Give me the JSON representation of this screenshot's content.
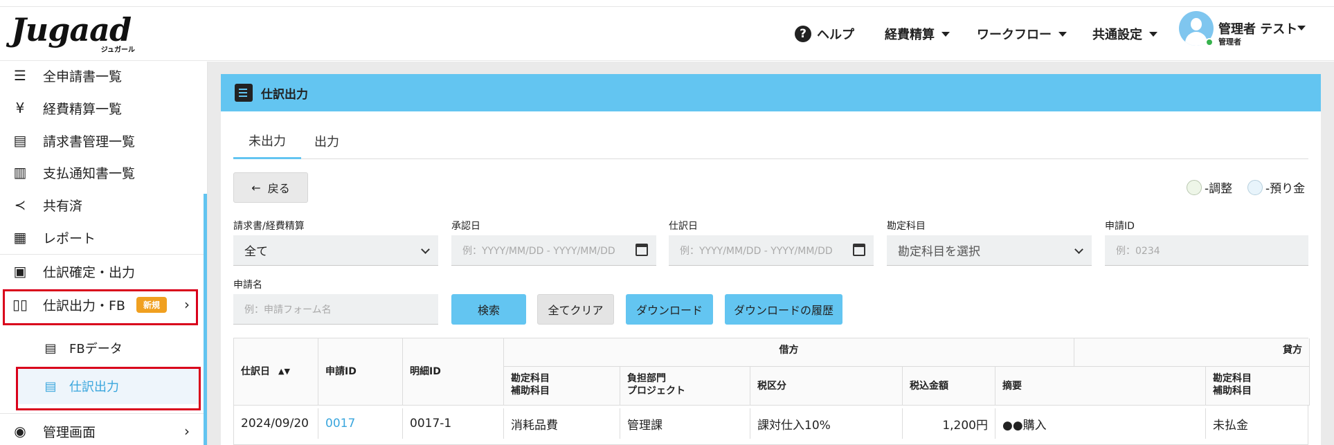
{
  "app": {
    "logo_text": "Jugaad",
    "logo_sub": "ジュガール"
  },
  "header": {
    "help": "ヘルプ",
    "menu_expense": "経費精算",
    "menu_workflow": "ワークフロー",
    "menu_common": "共通設定",
    "user_name": "管理者 テスト",
    "user_role": "管理者"
  },
  "sidebar": {
    "items": [
      {
        "label": "全申請書一覧",
        "icon": "list-icon"
      },
      {
        "label": "経費精算一覧",
        "icon": "yen-icon"
      },
      {
        "label": "請求書管理一覧",
        "icon": "document-icon"
      },
      {
        "label": "支払通知書一覧",
        "icon": "receipt-icon"
      },
      {
        "label": "共有済",
        "icon": "share-icon"
      },
      {
        "label": "レポート",
        "icon": "grid-icon"
      },
      {
        "label": "仕訳確定・出力",
        "icon": "journal-icon"
      },
      {
        "label": "仕訳出力・FB",
        "icon": "book-icon",
        "badge": "新規"
      }
    ],
    "sub_items": [
      {
        "label": "FBデータ",
        "icon": "fb-data-icon"
      },
      {
        "label": "仕訳出力",
        "icon": "journal-output-icon"
      }
    ],
    "admin": "管理画面"
  },
  "page": {
    "title": "仕訳出力",
    "tabs": [
      "未出力",
      "出力"
    ],
    "back_button": "戻る",
    "legend_adjust": "-調整",
    "legend_deposit": "-預り金"
  },
  "filters": {
    "type_label": "請求書/経費精算",
    "type_value": "全て",
    "approval_label": "承認日",
    "approval_placeholder": "例：YYYY/MM/DD - YYYY/MM/DD",
    "journal_label": "仕訳日",
    "journal_placeholder": "例：YYYY/MM/DD - YYYY/MM/DD",
    "account_label": "勘定科目",
    "account_placeholder": "勘定科目を選択",
    "id_label": "申請ID",
    "id_placeholder": "例：0234",
    "name_label": "申請名",
    "name_placeholder": "例：申請フォーム名"
  },
  "actions": {
    "search": "検索",
    "clear": "全てクリア",
    "download": "ダウンロード",
    "history": "ダウンロードの履歴"
  },
  "table": {
    "col_date": "仕訳日",
    "col_id": "申請ID",
    "col_detail": "明細ID",
    "group_debit": "借方",
    "group_credit": "貸方",
    "sub_account": "勘定科目",
    "sub_account2": "補助科目",
    "sub_dept": "負担部門",
    "sub_project": "プロジェクト",
    "sub_tax": "税区分",
    "sub_amount": "税込金額",
    "sub_memo": "摘要",
    "rows": [
      {
        "date": "2024/09/20",
        "id": "0017",
        "detail": "0017-1",
        "account": "消耗品費",
        "dept": "管理課",
        "tax": "課対仕入10%",
        "amount": "1,200円",
        "memo": "●●購入",
        "credit_account": "未払金"
      }
    ]
  },
  "colors": {
    "accent": "#63c5f1",
    "highlight": "#d9001b",
    "badge": "#f0a020"
  }
}
